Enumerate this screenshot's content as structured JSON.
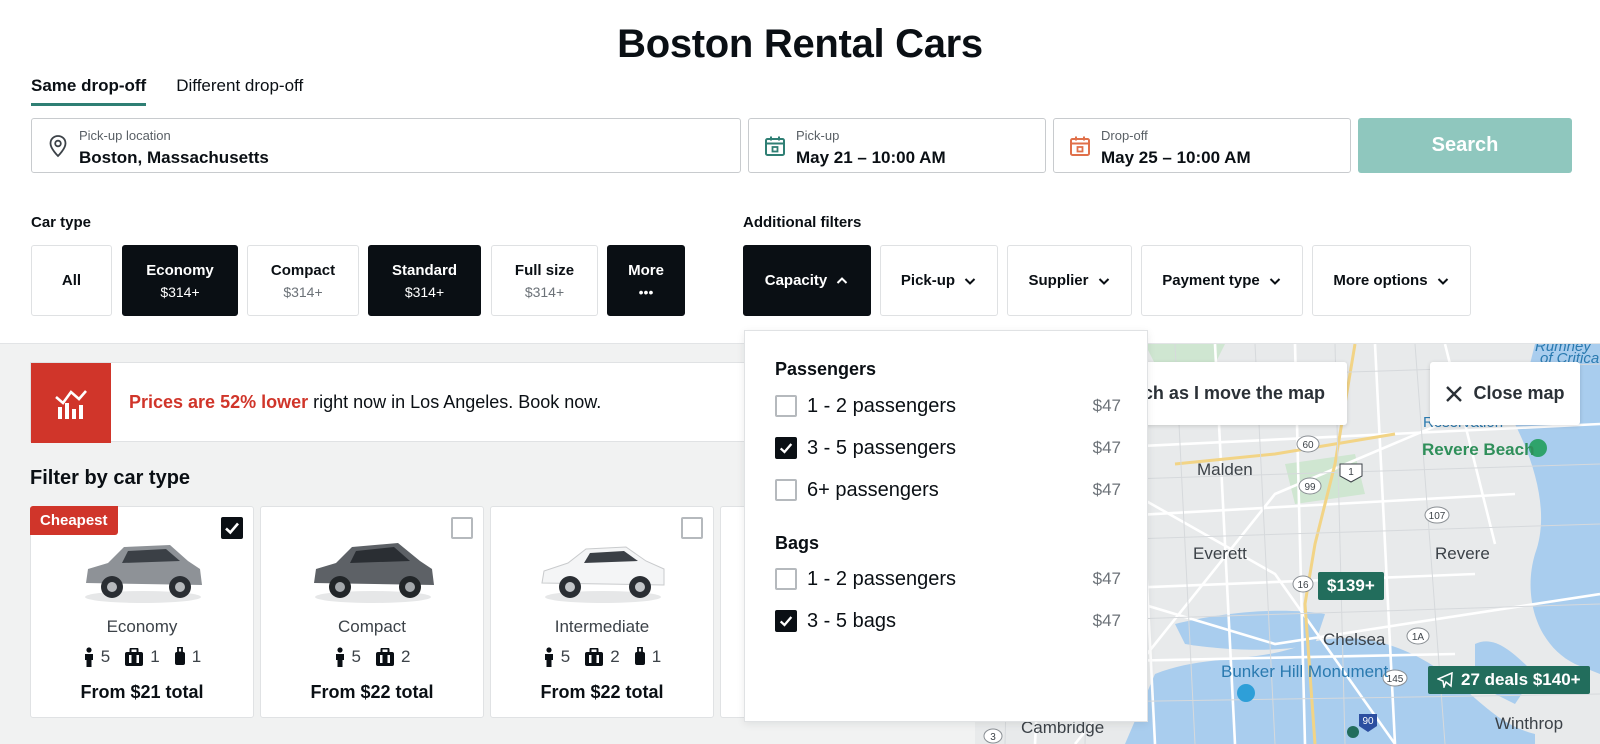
{
  "page": {
    "title": "Boston Rental Cars"
  },
  "tabs": [
    {
      "label": "Same drop-off",
      "active": true
    },
    {
      "label": "Different drop-off",
      "active": false
    }
  ],
  "search": {
    "location_label": "Pick-up location",
    "location_value": "Boston, Massachusetts",
    "pickup_label": "Pick-up",
    "pickup_value": "May 21 – 10:00 AM",
    "dropoff_label": "Drop-off",
    "dropoff_value": "May 25 – 10:00 AM",
    "button_label": "Search"
  },
  "car_type": {
    "label": "Car type",
    "chips": [
      {
        "name": "All",
        "price": "",
        "selected": false
      },
      {
        "name": "Economy",
        "price": "$314+",
        "selected": true
      },
      {
        "name": "Compact",
        "price": "$314+",
        "selected": false
      },
      {
        "name": "Standard",
        "price": "$314+",
        "selected": true
      },
      {
        "name": "Full size",
        "price": "$314+",
        "selected": false
      },
      {
        "name": "More",
        "price": "•••",
        "selected": true
      }
    ]
  },
  "additional_filters": {
    "label": "Additional filters",
    "buttons": [
      {
        "label": "Capacity",
        "open": true
      },
      {
        "label": "Pick-up",
        "open": false
      },
      {
        "label": "Supplier",
        "open": false
      },
      {
        "label": "Payment type",
        "open": false
      },
      {
        "label": "More options",
        "open": false
      }
    ]
  },
  "promo": {
    "highlight": "Prices are 52% lower",
    "text": " right now in Los Angeles.  Book now."
  },
  "filter_by_car_type": {
    "title": "Filter by car type",
    "cards": [
      {
        "badge": "Cheapest",
        "checked": true,
        "name": "Economy",
        "passengers": "5",
        "bags": "1",
        "carry_on": "1",
        "price": "From $21 total"
      },
      {
        "badge": "",
        "checked": false,
        "name": "Compact",
        "passengers": "5",
        "bags": "2",
        "carry_on": "",
        "price": "From $22 total"
      },
      {
        "badge": "",
        "checked": false,
        "name": "Intermediate",
        "passengers": "5",
        "bags": "2",
        "carry_on": "1",
        "price": "From $22 total"
      }
    ]
  },
  "capacity_dropdown": {
    "passengers_heading": "Passengers",
    "passengers": [
      {
        "label": "1 - 2 passengers",
        "price": "$47",
        "checked": false
      },
      {
        "label": "3 - 5 passengers",
        "price": "$47",
        "checked": true
      },
      {
        "label": "6+ passengers",
        "price": "$47",
        "checked": false
      }
    ],
    "bags_heading": "Bags",
    "bags": [
      {
        "label": "1 - 2 passengers",
        "price": "$47",
        "checked": false
      },
      {
        "label": "3 - 5 bags",
        "price": "$47",
        "checked": true
      }
    ]
  },
  "map": {
    "search_toggle_label": "ch as I move the map",
    "close_label": "Close map",
    "pin_price": "$139+",
    "deals_label": "27 deals $140+",
    "places": [
      "Malden",
      "Everett",
      "Revere",
      "Revere Beach",
      "Chelsea",
      "Bunker Hill Monument",
      "Cambridge",
      "Winthrop"
    ],
    "top_partial": "Reservation",
    "top_right_partial": "of Critica",
    "top_right_partial2": "Rumney",
    "route_shields": [
      "60",
      "1",
      "99",
      "107",
      "16",
      "1A",
      "145",
      "90",
      "3"
    ]
  },
  "colors": {
    "accent": "#2f7f74",
    "search_button": "#8fc7be",
    "dark": "#0a0f14",
    "promo_red": "#d0352a",
    "map_pin": "#226d5c",
    "map_water": "#a9cdee"
  }
}
